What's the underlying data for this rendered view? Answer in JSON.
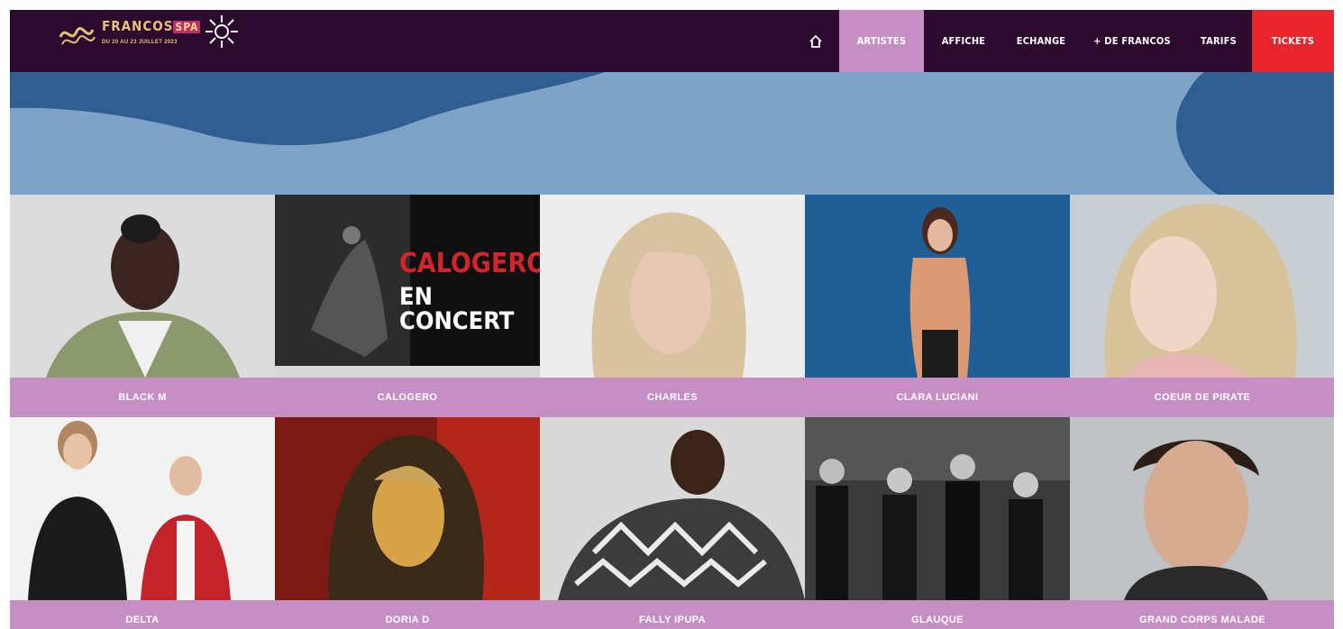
{
  "header": {
    "logo": {
      "title": "FRANCOS",
      "suffix": "SPA",
      "dates": "DU 20 AU 23 JUILLET 2023"
    },
    "nav": [
      {
        "label": "ARTISTES",
        "active": true
      },
      {
        "label": "AFFICHE",
        "active": false
      },
      {
        "label": "ECHANGE",
        "active": false
      },
      {
        "label": "+ DE FRANCOS",
        "active": false
      },
      {
        "label": "TARIFS",
        "active": false
      },
      {
        "label": "TICKETS",
        "active": false
      }
    ]
  },
  "artists": [
    {
      "name": "BLACK M"
    },
    {
      "name": "CALOGERO",
      "poster_line1": "CALOGERO",
      "poster_line2": "EN CONCERT"
    },
    {
      "name": "CHARLES"
    },
    {
      "name": "CLARA LUCIANI"
    },
    {
      "name": "COEUR DE PIRATE"
    },
    {
      "name": "DELTA"
    },
    {
      "name": "DORIA D"
    },
    {
      "name": "FALLY IPUPA"
    },
    {
      "name": "GLAUQUE"
    },
    {
      "name": "GRAND CORPS MALADE"
    }
  ],
  "colors": {
    "header_bg": "#2b0a2e",
    "accent_pink": "#c58fc4",
    "tickets_red": "#e8242d",
    "banner_light_blue": "#7fa2c7",
    "banner_dark_blue": "#2f5e93",
    "logo_gold": "#e7c07a"
  }
}
